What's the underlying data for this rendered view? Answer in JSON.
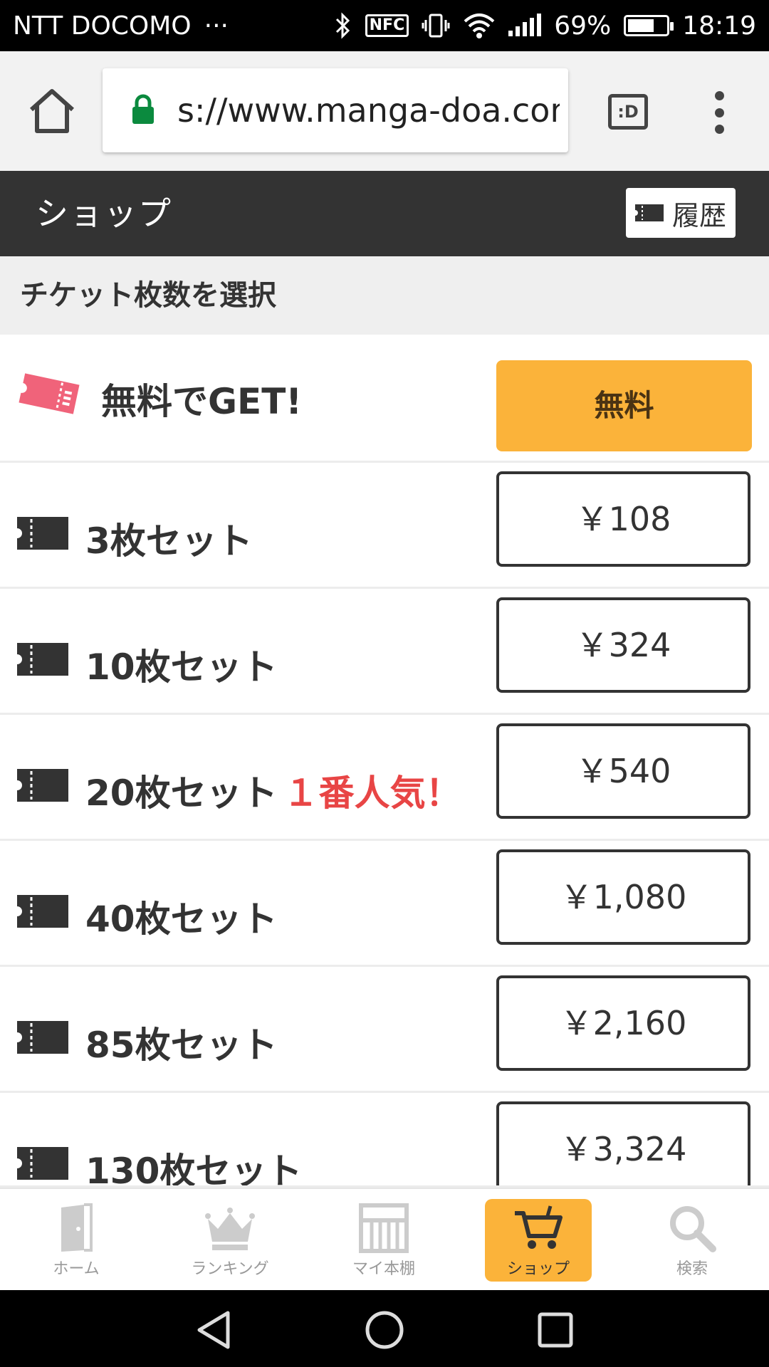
{
  "status_bar": {
    "carrier": "NTT DOCOMO",
    "more": "···",
    "nfc": "NFC",
    "battery": "69%",
    "battery_level": 0.69,
    "time": "18:19"
  },
  "browser": {
    "url": "s://www.manga-doa.com",
    "tab_icon": ":D"
  },
  "header": {
    "title": "ショップ",
    "history_label": "履歴"
  },
  "section": {
    "title": "チケット枚数を選択"
  },
  "free_offer": {
    "label": "無料でGET!",
    "button": "無料"
  },
  "ticket_sets": [
    {
      "label": "3枚セット",
      "price": "￥108",
      "badge": ""
    },
    {
      "label": "10枚セット",
      "price": "￥324",
      "badge": ""
    },
    {
      "label": "20枚セット",
      "price": "￥540",
      "badge": "１番人気！"
    },
    {
      "label": "40枚セット",
      "price": "￥1,080",
      "badge": ""
    },
    {
      "label": "85枚セット",
      "price": "￥2,160",
      "badge": ""
    },
    {
      "label": "130枚セット",
      "price": "￥3,324",
      "badge": ""
    }
  ],
  "bottom_nav": [
    {
      "label": "ホーム",
      "icon": "door-icon",
      "active": false
    },
    {
      "label": "ランキング",
      "icon": "crown-icon",
      "active": false
    },
    {
      "label": "マイ本棚",
      "icon": "bookshelf-icon",
      "active": false
    },
    {
      "label": "ショップ",
      "icon": "cart-icon",
      "active": true
    },
    {
      "label": "検索",
      "icon": "search-icon",
      "active": false
    }
  ],
  "colors": {
    "header_bg": "#333333",
    "accent": "#fbb33a",
    "popular": "#e84545",
    "free_ticket": "#f0637a"
  }
}
